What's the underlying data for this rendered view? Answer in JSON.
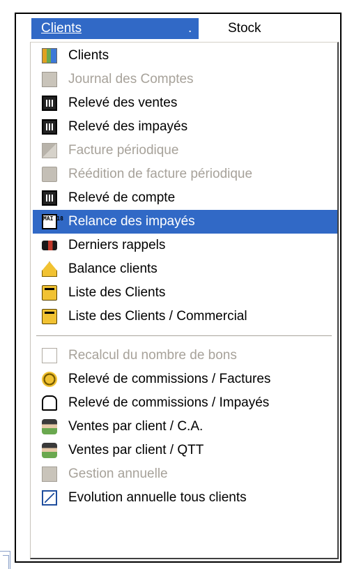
{
  "menubar": {
    "clients": "Clients",
    "clients_dot": ".",
    "stock": "Stock"
  },
  "menu": [
    {
      "label": "Clients",
      "icon": "people-icon",
      "state": "normal"
    },
    {
      "label": "Journal des Comptes",
      "icon": "journal-icon",
      "state": "disabled"
    },
    {
      "label": "Relevé des ventes",
      "icon": "calculator-icon",
      "state": "normal"
    },
    {
      "label": "Relevé des impayés",
      "icon": "calculator-icon",
      "state": "normal"
    },
    {
      "label": "Facture périodique",
      "icon": "invoice-icon",
      "state": "disabled"
    },
    {
      "label": "Réédition de facture périodique",
      "icon": "printer-icon",
      "state": "disabled"
    },
    {
      "label": "Relevé de compte",
      "icon": "calculator-icon",
      "state": "normal"
    },
    {
      "label": "Relance des impayés",
      "icon": "calendar-icon",
      "state": "selected",
      "icon_text": "MAI 18"
    },
    {
      "label": "Derniers rappels",
      "icon": "hand-icon",
      "state": "normal"
    },
    {
      "label": "Balance clients",
      "icon": "scale-icon",
      "state": "normal"
    },
    {
      "label": "Liste des Clients",
      "icon": "folder-icon",
      "state": "normal"
    },
    {
      "label": "Liste des Clients / Commercial",
      "icon": "folder-icon",
      "state": "normal"
    },
    {
      "label": "Recalcul du nombre de bons",
      "icon": "recalc-icon",
      "state": "disabled"
    },
    {
      "label": "Relevé de commissions / Factures",
      "icon": "coins-icon",
      "state": "normal"
    },
    {
      "label": "Relevé de commissions / Impayés",
      "icon": "lock-icon",
      "state": "normal"
    },
    {
      "label": "Ventes par client / C.A.",
      "icon": "man-icon",
      "state": "normal"
    },
    {
      "label": "Ventes par client / QTT",
      "icon": "man-icon",
      "state": "normal"
    },
    {
      "label": "Gestion annuelle",
      "icon": "gestion-icon",
      "state": "disabled"
    },
    {
      "label": "Evolution annuelle tous clients",
      "icon": "graph-icon",
      "state": "normal"
    }
  ],
  "colors": {
    "highlight": "#3169c6",
    "disabled_text": "#a7a29a",
    "text": "#000000"
  }
}
